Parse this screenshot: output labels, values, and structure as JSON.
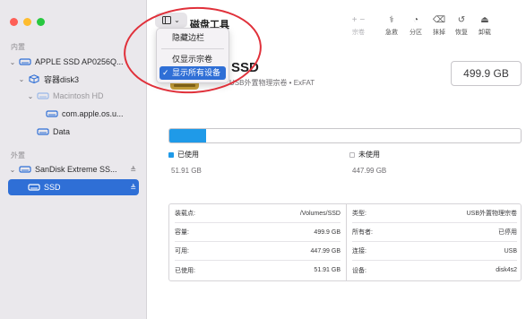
{
  "window": {
    "title": "磁盘工具",
    "traffic_lights": [
      "#fe5f57",
      "#febc2e",
      "#28c840"
    ]
  },
  "sidebar": {
    "sections": [
      {
        "label": "内置",
        "items": [
          {
            "label": "APPLE SSD AP0256Q...",
            "icon": "drive-icon",
            "expanded": true
          },
          {
            "label": "容器disk3",
            "icon": "container-icon",
            "expanded": true
          },
          {
            "label": "Macintosh HD",
            "icon": "volume-icon",
            "expanded": true,
            "dimmed": true
          },
          {
            "label": "com.apple.os.u...",
            "icon": "volume-icon"
          },
          {
            "label": "Data",
            "icon": "volume-icon"
          }
        ]
      },
      {
        "label": "外置",
        "items": [
          {
            "label": "SanDisk Extreme SS...",
            "icon": "drive-icon",
            "expanded": true,
            "eject": "≜"
          },
          {
            "label": "SSD",
            "icon": "volume-icon",
            "selected": true,
            "eject": "≜"
          }
        ]
      }
    ]
  },
  "toolbar": {
    "sidebar_toggle_icon": "sidebar-toggle-icon",
    "buttons": [
      {
        "label": "宗卷",
        "glyph": "+ −",
        "disabled": true
      },
      {
        "label": "急救",
        "glyph": "⚕",
        "icon": "first-aid-icon"
      },
      {
        "label": "分区",
        "glyph": "◔",
        "icon": "partition-icon"
      },
      {
        "label": "抹掉",
        "glyph": "⌫",
        "icon": "erase-icon"
      },
      {
        "label": "恢复",
        "glyph": "↺",
        "icon": "restore-icon"
      },
      {
        "label": "卸载",
        "glyph": "⏏",
        "icon": "unmount-icon"
      }
    ]
  },
  "dropdown": {
    "items": [
      {
        "label": "隐藏边栏"
      },
      {
        "label": "仅显示宗卷"
      },
      {
        "label": "显示所有设备",
        "checked": true
      }
    ],
    "check": "✓"
  },
  "volume": {
    "name": "SSD",
    "subtitle": "USB外置物理宗卷 • ExFAT",
    "capacity": "499.9 GB",
    "used_fraction": 0.104,
    "used_color": "#1f9ae8",
    "free_color": "#ffffff",
    "legend": [
      {
        "label": "已使用",
        "value": "51.91 GB"
      },
      {
        "label": "未使用",
        "value": "447.99 GB"
      }
    ]
  },
  "info": {
    "left": [
      {
        "key": "装载点:",
        "value": "/Volumes/SSD"
      },
      {
        "key": "容量:",
        "value": "499.9 GB"
      },
      {
        "key": "可用:",
        "value": "447.99 GB"
      },
      {
        "key": "已使用:",
        "value": "51.91 GB"
      }
    ],
    "right": [
      {
        "key": "类型:",
        "value": "USB外置物理宗卷"
      },
      {
        "key": "所有者:",
        "value": "已停用"
      },
      {
        "key": "连接:",
        "value": "USB"
      },
      {
        "key": "设备:",
        "value": "disk4s2"
      }
    ]
  }
}
